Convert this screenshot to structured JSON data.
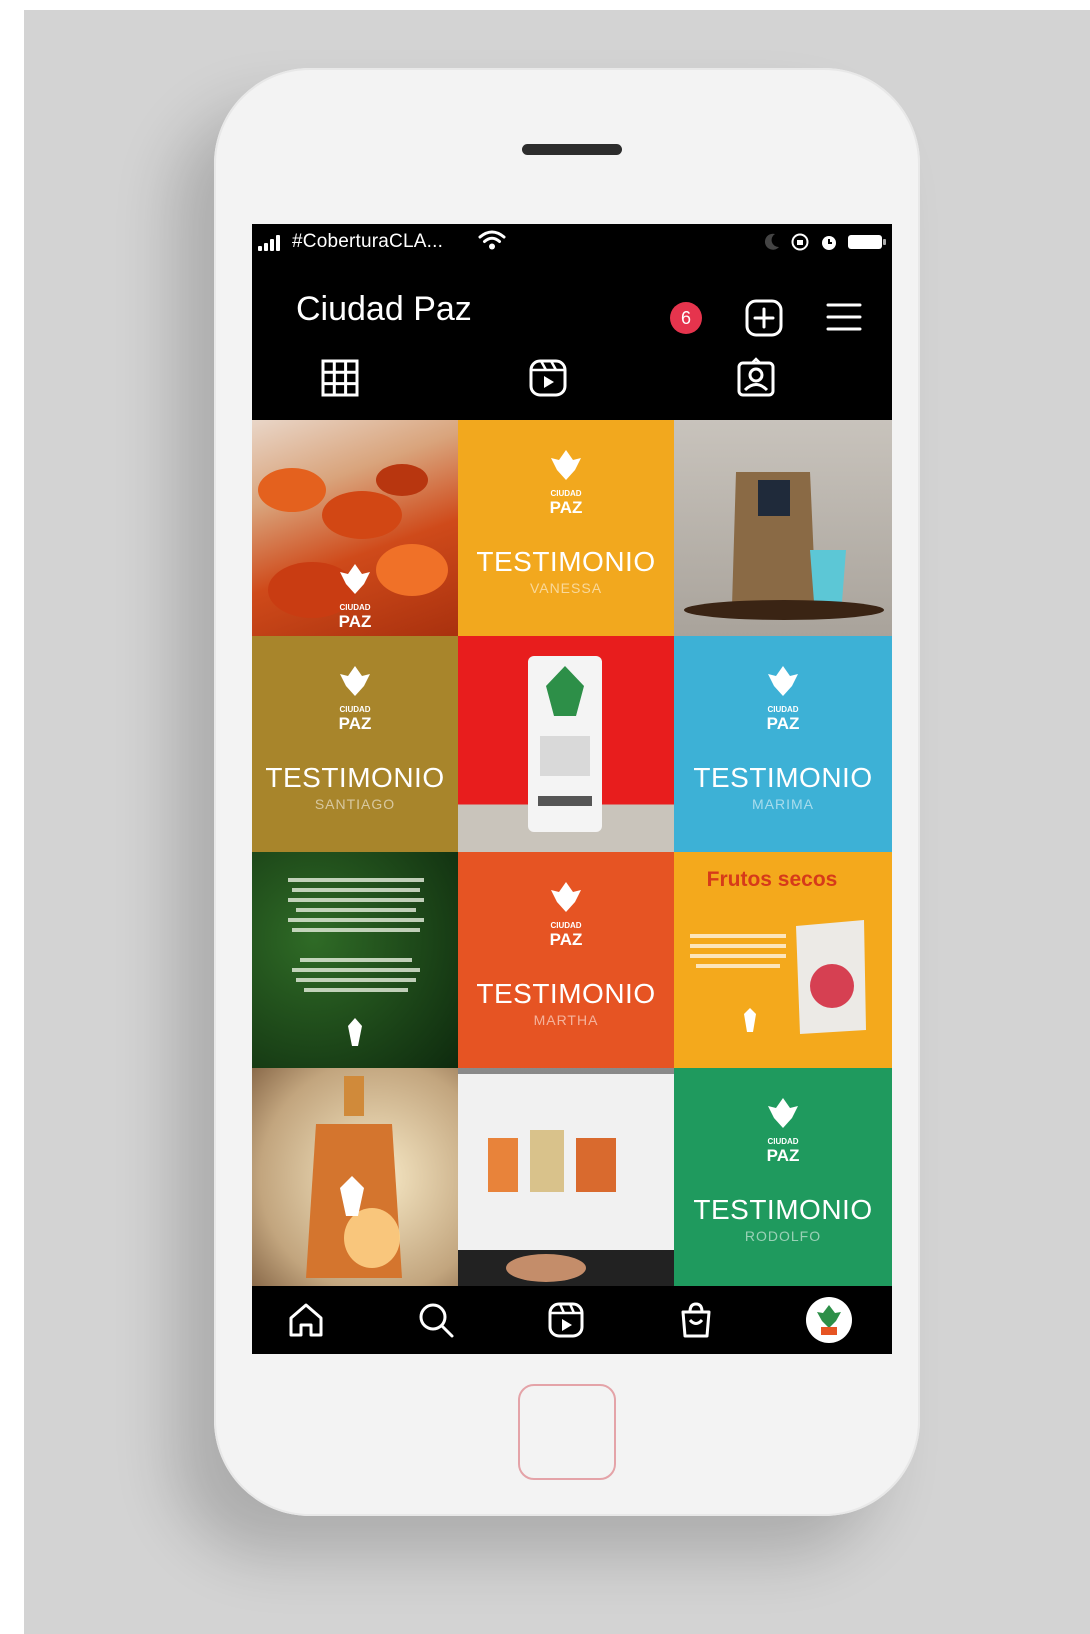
{
  "status_bar": {
    "carrier": "#CoberturaCLA...",
    "icons": [
      "signal-icon",
      "wifi-icon",
      "moon-icon",
      "rotation-lock-icon",
      "alarm-icon",
      "battery-icon"
    ]
  },
  "header": {
    "title": "Ciudad Paz",
    "notification_count": "6",
    "icons": [
      "add-post-icon",
      "menu-icon"
    ]
  },
  "profile_tabs": [
    "grid-icon",
    "reels-icon",
    "tagged-icon"
  ],
  "brand": {
    "ciudad": "CIUDAD",
    "paz": "PAZ"
  },
  "posts": [
    {
      "kind": "photo",
      "subject": "dried fruit chips",
      "color": "#d8592a"
    },
    {
      "kind": "testimonial",
      "label": "TESTIMONIO",
      "name": "VANESSA",
      "color": "#f2a81e"
    },
    {
      "kind": "photo",
      "subject": "coffee bag and cup",
      "color": "#b9b4ad"
    },
    {
      "kind": "testimonial",
      "label": "TESTIMONIO",
      "name": "SANTIAGO",
      "color": "#a8852b"
    },
    {
      "kind": "photo",
      "subject": "product package on red",
      "color": "#e81d1d"
    },
    {
      "kind": "testimonial",
      "label": "TESTIMONIO",
      "name": "MARIMA",
      "color": "#3db1d6"
    },
    {
      "kind": "text",
      "subject": "green text post",
      "color": "#1d4d1d"
    },
    {
      "kind": "testimonial",
      "label": "TESTIMONIO",
      "name": "MARTHA",
      "color": "#e65423"
    },
    {
      "kind": "product",
      "title": "Frutos secos",
      "color": "#f4a91c"
    },
    {
      "kind": "photo",
      "subject": "bottle with light",
      "color": "#c98a5a"
    },
    {
      "kind": "photo",
      "subject": "laptop website",
      "color": "#6b6b6b"
    },
    {
      "kind": "testimonial",
      "label": "TESTIMONIO",
      "name": "RODOLFO",
      "color": "#1f9a5e"
    }
  ],
  "bottom_nav": [
    "home-icon",
    "search-icon",
    "reels-icon",
    "shop-icon",
    "profile-avatar"
  ]
}
